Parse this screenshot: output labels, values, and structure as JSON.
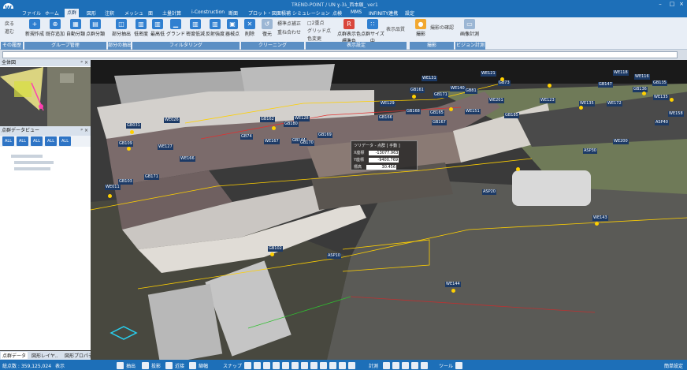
{
  "app": {
    "logo": "W",
    "window_title": "TREND-POINT / UN ɣ-3ﾑ_西本願_ ver1"
  },
  "menu": {
    "items": [
      "ファイル",
      "ホーム",
      "点群",
      "図形",
      "注釈",
      "メッシュ",
      "面",
      "土量計算",
      "i-Construction",
      "断面",
      "プロット・図面積補",
      "シミュレーション",
      "点検",
      "MMS",
      "INFINITY連携",
      "設定"
    ],
    "active": "点群"
  },
  "ribbon": {
    "small_left": [
      "戻る",
      "進む"
    ],
    "group1_buttons": [
      "新規作成",
      "既存追加",
      "自動分類",
      "点群分類"
    ],
    "group1_label": "グループ管理",
    "group0_label": "その履歴",
    "group2_buttons": [
      "部分抽出"
    ],
    "group2_label": "部分の抽出",
    "group3_buttons": [
      "低密度",
      "最高低",
      "グランド",
      "密度低減",
      "反射強度",
      "器械点"
    ],
    "group3_label": "フィルタリング",
    "group4_buttons": [
      "削除",
      "復元"
    ],
    "group4_small": [
      "標準点補正",
      "重ね合わせ"
    ],
    "group4_label": "クリーニング",
    "group5_small": [
      "□2重点",
      "グリッド点",
      "色変更"
    ],
    "group5_buttons": [
      "点群表示色",
      "点群サイズ",
      "表示品質"
    ],
    "group5_sub": [
      "標準色",
      "中"
    ],
    "group5_label": "表示設定",
    "group6_buttons": [
      "撮影",
      "撮影の確認"
    ],
    "group6_label": "撮影",
    "group7_buttons": [
      "画像計測"
    ],
    "group7_sub": "画像計測",
    "group7_label": "ビジョン計測"
  },
  "left_panel": {
    "overview_title": "全体図",
    "points_title": "点群データビュー",
    "tree_buttons": [
      "ALL",
      "ALL",
      "ALL",
      "ALL",
      "ALL"
    ],
    "tabs": [
      "点群データ",
      "図形レイヤ..",
      "図形プロパティ..."
    ]
  },
  "scene": {
    "labels": [
      {
        "t": "WE121"
      },
      {
        "t": "GB73"
      },
      {
        "t": "WE131"
      },
      {
        "t": "GB161"
      },
      {
        "t": "GB171"
      },
      {
        "t": "WE129"
      },
      {
        "t": "WE140"
      },
      {
        "t": "GB81"
      },
      {
        "t": "GB162"
      },
      {
        "t": "GB167"
      },
      {
        "t": "WE128"
      },
      {
        "t": "GB180"
      },
      {
        "t": "GB166"
      },
      {
        "t": "GB168"
      },
      {
        "t": "WE151"
      },
      {
        "t": "GB74"
      },
      {
        "t": "WE167"
      },
      {
        "t": "GB144"
      },
      {
        "t": "GB170"
      },
      {
        "t": "GB169"
      },
      {
        "t": "GB109"
      },
      {
        "t": "WE127"
      },
      {
        "t": "WE026"
      },
      {
        "t": "GB031"
      },
      {
        "t": "WE166"
      },
      {
        "t": "GB171"
      },
      {
        "t": "GB103"
      },
      {
        "t": "WE011"
      },
      {
        "t": "GB165"
      },
      {
        "t": "WE201"
      },
      {
        "t": "GB185"
      },
      {
        "t": "WE135"
      },
      {
        "t": "WE123"
      },
      {
        "t": "WE200"
      },
      {
        "t": "ASP30"
      },
      {
        "t": "ASP20"
      },
      {
        "t": "WE143"
      },
      {
        "t": "GB102"
      },
      {
        "t": "ASP10"
      },
      {
        "t": "WE144"
      },
      {
        "t": "ASP40"
      },
      {
        "t": "WE158"
      },
      {
        "t": "WE172"
      },
      {
        "t": "GB136"
      },
      {
        "t": "WE135"
      },
      {
        "t": "WE118"
      },
      {
        "t": "GB135"
      },
      {
        "t": "GB147"
      },
      {
        "t": "WE116"
      }
    ],
    "info_title": "ツリデータ - 点群 [ 手動 ]",
    "info_rows": [
      {
        "k": "X座標",
        "v": "-13077.963"
      },
      {
        "k": "Y座標",
        "v": "-9400.769"
      },
      {
        "k": "標高",
        "v": "30.456"
      }
    ]
  },
  "status": {
    "count_label": "総点数 : 359,125,024",
    "display": "表示",
    "items": [
      "抽出",
      "投影",
      "近接",
      "縮幅",
      "スナップ",
      "計測",
      "ツール"
    ],
    "right": "簡単設定"
  },
  "colors": {
    "brand": "#1d6fb8",
    "ribbon": "#e8eef6",
    "label_bg": "#1c3a66",
    "point_marker": "#ffd000"
  }
}
